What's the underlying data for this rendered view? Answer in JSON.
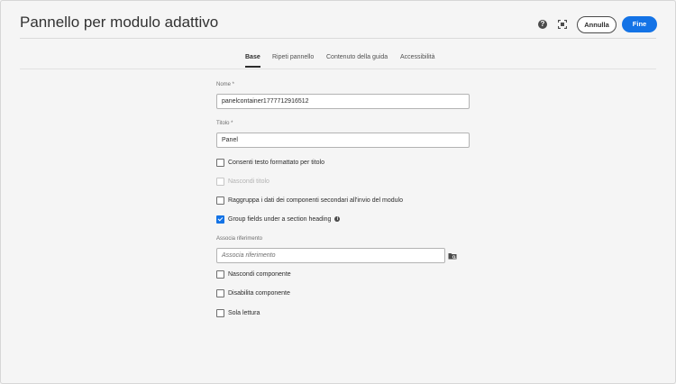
{
  "header": {
    "title": "Pannello per modulo adattivo",
    "help_icon": "help-icon",
    "fullscreen_icon": "fullscreen-icon",
    "cancel_label": "Annulla",
    "done_label": "Fine"
  },
  "tabs": [
    {
      "label": "Base",
      "active": true
    },
    {
      "label": "Ripeti pannello",
      "active": false
    },
    {
      "label": "Contenuto della guida",
      "active": false
    },
    {
      "label": "Accessibilità",
      "active": false
    }
  ],
  "form": {
    "name_label": "Nome *",
    "name_value": "panelcontainer1777712916512",
    "title_label": "Titolo *",
    "title_value": "Panel",
    "cb_rich_text": {
      "label": "Consenti testo formattato per titolo",
      "checked": false,
      "disabled": false
    },
    "cb_hide_title": {
      "label": "Nascondi titolo",
      "checked": false,
      "disabled": true
    },
    "cb_group_data": {
      "label": "Raggruppa i dati dei componenti secondari all'invio del modulo",
      "checked": false,
      "disabled": false
    },
    "cb_group_fields": {
      "label": "Group fields under a section heading",
      "checked": true,
      "disabled": false
    },
    "bind_ref_label": "Associa riferimento",
    "bind_ref_placeholder": "Associa riferimento",
    "cb_hide_component": {
      "label": "Nascondi componente",
      "checked": false,
      "disabled": false
    },
    "cb_disable_component": {
      "label": "Disabilita componente",
      "checked": false,
      "disabled": false
    },
    "cb_read_only": {
      "label": "Sola lettura",
      "checked": false,
      "disabled": false
    }
  },
  "colors": {
    "accent": "#1473e6",
    "background": "#f5f5f5"
  }
}
